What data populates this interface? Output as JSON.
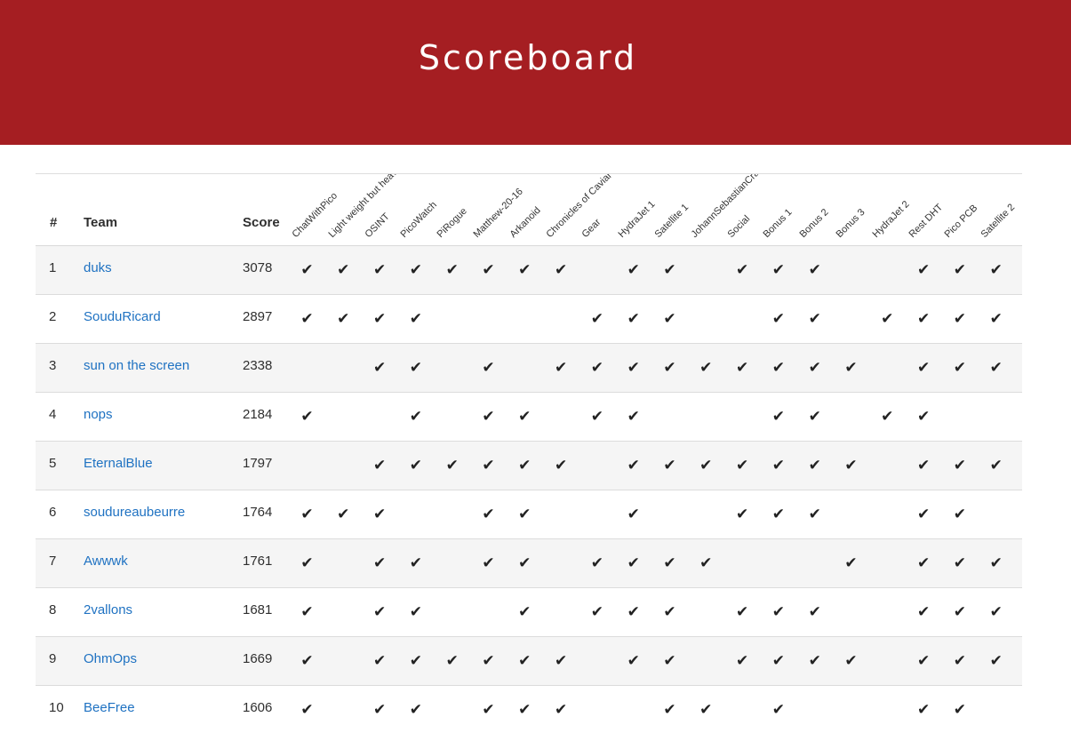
{
  "page": {
    "title": "Scoreboard",
    "accent_color": "#a51e22",
    "link_color": "#1f72c2",
    "check_glyph": "✔"
  },
  "table": {
    "columns": {
      "rank": "#",
      "team": "Team",
      "score": "Score"
    },
    "challenges": [
      "ChatWithPico",
      "Light weight but heavy",
      "OSINT",
      "PicoWatch",
      "PiRogue",
      "Matthew-20-16",
      "Arkanoid",
      "Chronicles of Caviar",
      "Gear",
      "HydraJet 1",
      "Satellite 1",
      "JohannSebastianCrab",
      "Social",
      "Bonus 1",
      "Bonus 2",
      "Bonus 3",
      "HydraJet 2",
      "Rest DHT",
      "Pico PCB",
      "Satellite 2"
    ],
    "rows": [
      {
        "rank": "1",
        "team": "duks",
        "score": "3078",
        "solved": [
          0,
          1,
          2,
          3,
          4,
          5,
          6,
          7,
          9,
          10,
          12,
          13,
          14,
          17,
          18,
          19
        ]
      },
      {
        "rank": "2",
        "team": "SouduRicard",
        "score": "2897",
        "solved": [
          0,
          1,
          2,
          3,
          8,
          9,
          10,
          13,
          14,
          16,
          17,
          18,
          19
        ]
      },
      {
        "rank": "3",
        "team": "sun on the screen",
        "score": "2338",
        "solved": [
          2,
          3,
          5,
          7,
          8,
          9,
          10,
          11,
          12,
          13,
          14,
          15,
          17,
          18,
          19
        ]
      },
      {
        "rank": "4",
        "team": "nops",
        "score": "2184",
        "solved": [
          0,
          3,
          5,
          6,
          8,
          9,
          13,
          14,
          16,
          17
        ]
      },
      {
        "rank": "5",
        "team": "EternalBlue",
        "score": "1797",
        "solved": [
          2,
          3,
          4,
          5,
          6,
          7,
          9,
          10,
          11,
          12,
          13,
          14,
          15,
          17,
          18,
          19
        ]
      },
      {
        "rank": "6",
        "team": "soudureaubeurre",
        "score": "1764",
        "solved": [
          0,
          1,
          2,
          5,
          6,
          9,
          12,
          13,
          14,
          17,
          18
        ]
      },
      {
        "rank": "7",
        "team": "Awwwk",
        "score": "1761",
        "solved": [
          0,
          2,
          3,
          5,
          6,
          8,
          9,
          10,
          11,
          15,
          17,
          18,
          19
        ]
      },
      {
        "rank": "8",
        "team": "2vallons",
        "score": "1681",
        "solved": [
          0,
          2,
          3,
          6,
          8,
          9,
          10,
          12,
          13,
          14,
          17,
          18,
          19
        ]
      },
      {
        "rank": "9",
        "team": "OhmOps",
        "score": "1669",
        "solved": [
          0,
          2,
          3,
          4,
          5,
          6,
          7,
          9,
          10,
          12,
          13,
          14,
          15,
          17,
          18,
          19
        ]
      },
      {
        "rank": "10",
        "team": "BeeFree",
        "score": "1606",
        "solved": [
          0,
          2,
          3,
          5,
          6,
          7,
          10,
          11,
          13,
          17,
          18
        ]
      }
    ]
  }
}
